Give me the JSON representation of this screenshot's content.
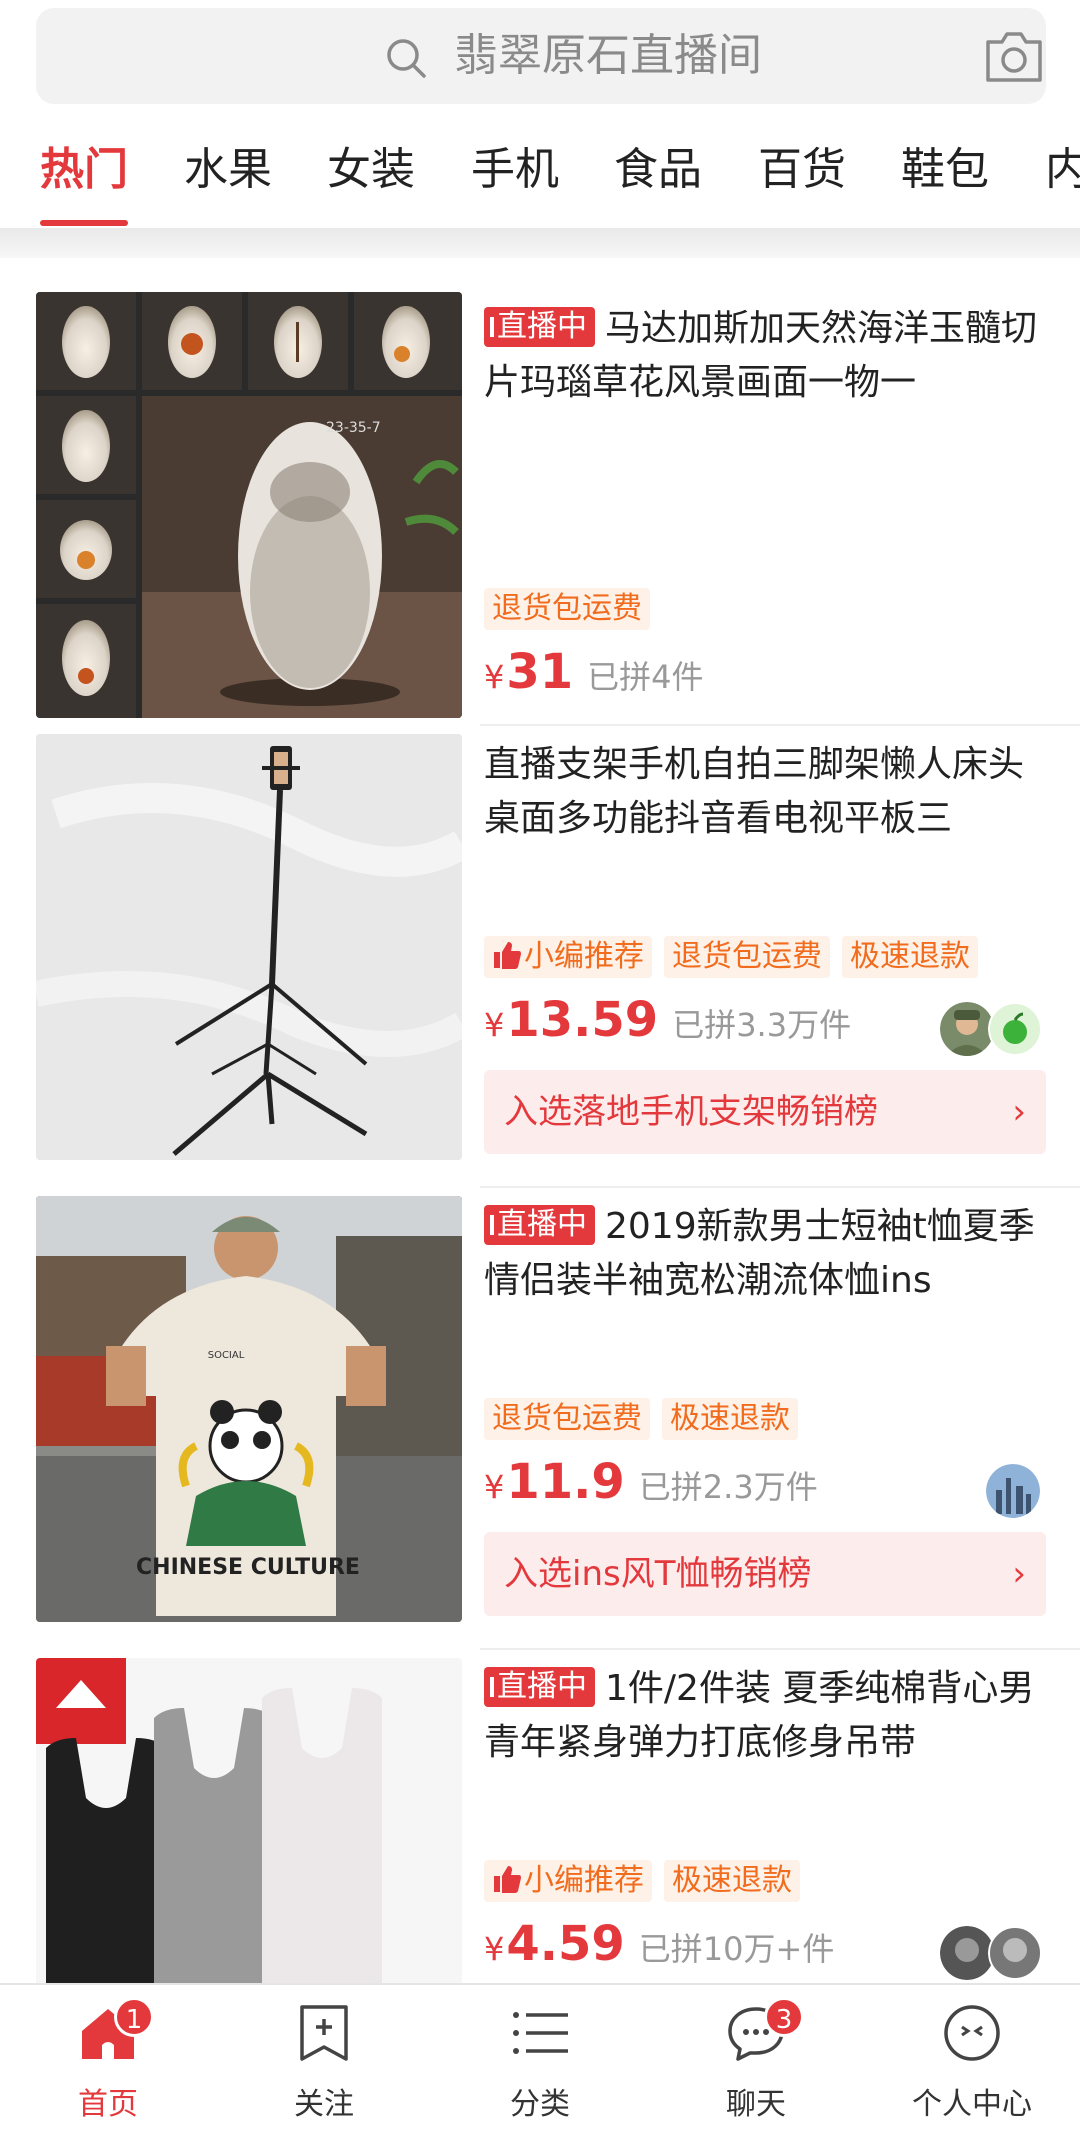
{
  "search": {
    "placeholder": "翡翠原石直播间"
  },
  "tabs": [
    "热门",
    "水果",
    "女装",
    "手机",
    "食品",
    "百货",
    "鞋包",
    "内"
  ],
  "active_tab": "热门",
  "colors": {
    "accent": "#e4393c",
    "tag_text": "#f26c1e",
    "tag_bg": "#fdf1e8",
    "rank_bg": "#fdecec"
  },
  "products": [
    {
      "live_badge": "直播中",
      "title": "马达加斯加天然海洋玉髓切片玛瑙草花风景画面一物一",
      "tags": [
        "退货包运费"
      ],
      "currency": "¥",
      "price": "31",
      "sold": "已拼4件",
      "image_caption": "23-35-7"
    },
    {
      "title": "直播支架手机自拍三脚架懒人床头桌面多功能抖音看电视平板三",
      "tags": [
        "小编推荐",
        "退货包运费",
        "极速退款"
      ],
      "currency": "¥",
      "price": "13.59",
      "sold": "已拼3.3万件",
      "rank": "入选落地手机支架畅销榜"
    },
    {
      "live_badge": "直播中",
      "title": "2019新款男士短袖t恤夏季情侣装半袖宽松潮流体恤ins",
      "tags": [
        "退货包运费",
        "极速退款"
      ],
      "currency": "¥",
      "price": "11.9",
      "sold": "已拼2.3万件",
      "rank": "入选ins风T恤畅销榜",
      "image_text": [
        "SOCIAL",
        "CHINESE CULTURE"
      ]
    },
    {
      "live_badge": "直播中",
      "title": "1件/2件装 夏季纯棉背心男青年紧身弹力打底修身吊带",
      "tags": [
        "小编推荐",
        "极速退款"
      ],
      "currency": "¥",
      "price": "4.59",
      "sold": "已拼10万+件"
    }
  ],
  "rank_chevron": "›",
  "nav": [
    {
      "label": "首页",
      "icon": "home-icon",
      "badge": "1"
    },
    {
      "label": "关注",
      "icon": "follow-icon"
    },
    {
      "label": "分类",
      "icon": "category-icon"
    },
    {
      "label": "聊天",
      "icon": "chat-icon",
      "badge": "3"
    },
    {
      "label": "个人中心",
      "icon": "profile-icon"
    }
  ]
}
